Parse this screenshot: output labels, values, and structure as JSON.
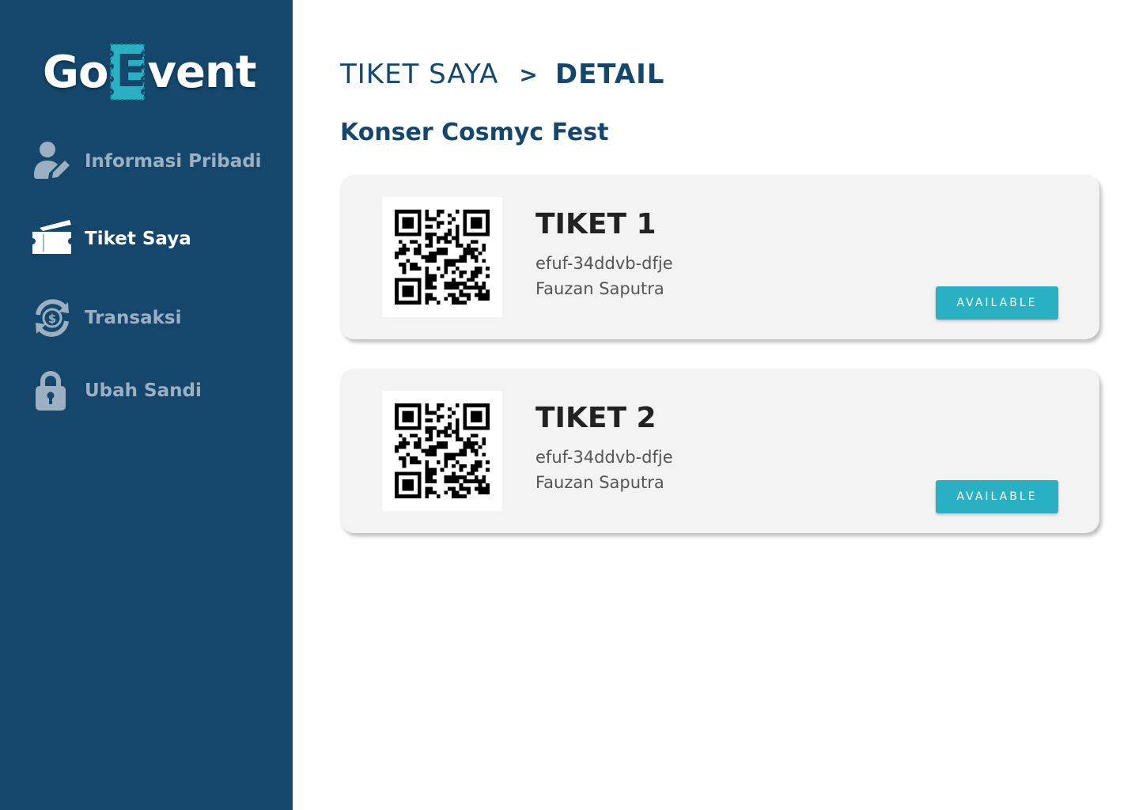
{
  "brand": {
    "logo_before": "Go",
    "logo_letter": "E",
    "logo_after": "vent",
    "accent": "#2ab0c3",
    "primary": "#14476b"
  },
  "sidebar": {
    "items": [
      {
        "label": "Informasi Pribadi",
        "icon": "user-edit-icon",
        "active": false
      },
      {
        "label": "Tiket Saya",
        "icon": "ticket-icon",
        "active": true
      },
      {
        "label": "Transaksi",
        "icon": "transaction-icon",
        "active": false
      },
      {
        "label": "Ubah Sandi",
        "icon": "lock-icon",
        "active": false
      }
    ]
  },
  "breadcrumb": {
    "parent": "TIKET SAYA",
    "separator": ">",
    "current": "DETAIL"
  },
  "event": {
    "title": "Konser Cosmyc Fest"
  },
  "tickets": [
    {
      "name": "TIKET 1",
      "code": "efuf-34ddvb-dfje",
      "owner": "Fauzan Saputra",
      "status": "AVAILABLE"
    },
    {
      "name": "TIKET 2",
      "code": "efuf-34ddvb-dfje",
      "owner": "Fauzan Saputra",
      "status": "AVAILABLE"
    }
  ]
}
